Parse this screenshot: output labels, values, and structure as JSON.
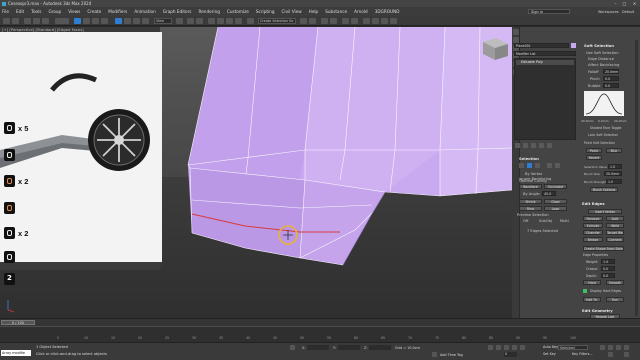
{
  "window": {
    "title": "Cesexopr3.max - Autodesk 3ds Max 2024",
    "sign_in": "Sign in",
    "workspaces_label": "Workspaces:",
    "workspace_value": "Default"
  },
  "menu": [
    "File",
    "Edit",
    "Tools",
    "Group",
    "Views",
    "Create",
    "Modifiers",
    "Animation",
    "Graph Editors",
    "Rendering",
    "Customize",
    "Scripting",
    "Civil View",
    "Help",
    "Substance",
    "Arnold",
    "3DGROUND"
  ],
  "toolbar": {
    "view_dropdown": "View",
    "selection_set": "Create Selection Se"
  },
  "viewport": {
    "label": "[+] [Perspective] [Standard] [Edged Faces]"
  },
  "reference": {
    "rows": [
      {
        "count": "x 5",
        "wheel_text": ""
      },
      {
        "count": "",
        "wheel_text": ""
      },
      {
        "count": "x 2",
        "wheel_text": ""
      },
      {
        "count": "",
        "wheel_text": ""
      },
      {
        "count": "x 2",
        "wheel_text": ""
      },
      {
        "count": "2",
        "wheel_text": ""
      }
    ]
  },
  "panel": {
    "object_name": "Plane001",
    "modifier_list": "Modifier List",
    "stack_item": "Editable Poly",
    "soft_selection": {
      "header": "Soft Selection",
      "use_soft": "Use Soft Selection",
      "edge_distance": "Edge Distance",
      "affect_backfacing": "Affect Backfacing",
      "falloff": "Falloff",
      "falloff_val": "20.0mm",
      "pinch": "Pinch",
      "pinch_val": "0.0",
      "bubble": "Bubble",
      "bubble_val": "0.0",
      "curve_ticks": [
        "20.0mm",
        "0.0mm",
        "20.0mm"
      ],
      "shaded_face": "Shaded Face Toggle",
      "lock_soft": "Lock Soft Selection",
      "paint_header": "Paint Soft Selection",
      "paint": "Paint",
      "blur": "Blur",
      "revert": "Revert",
      "selection_value": "Selection Value",
      "sel_val": "1.0",
      "brush_size": "Brush Size",
      "brush_size_val": "20.0mm",
      "brush_strength": "Brush Strength",
      "brush_strength_val": "1.0",
      "brush_options": "Brush Options"
    },
    "selection": {
      "header": "Selection",
      "by_vertex": "By Vertex",
      "ignore_backfacing": "Ignore Backfacing",
      "by_angle": "By Angle:",
      "angle_val": "45.0",
      "shrink": "Shrink",
      "grow": "Grow",
      "ring": "Ring",
      "loop": "Loop",
      "preview": "Preview Selection",
      "off": "Off",
      "subobj": "SubObj",
      "multi": "Multi",
      "status": "7 Edges Selected",
      "optimal_culling": "Optimal Culling",
      "backface": "Backface",
      "occluded": "Occluded"
    },
    "edit_edges": {
      "header": "Edit Edges",
      "insert_vertex": "Insert Vertex",
      "remove": "Remove",
      "split": "Split",
      "extrude": "Extrude",
      "weld": "Weld",
      "chamfer": "Chamfer",
      "target_weld": "Target Weld",
      "bridge": "Bridge",
      "connect": "Connect",
      "create_shape": "Create Shape From Selection",
      "edge_properties": "Edge Properties",
      "weight": "Weight:",
      "weight_val": "1.0",
      "crease": "Crease:",
      "crease_val": "0.0",
      "depth": "Depth:",
      "depth_val": "0.0",
      "hard": "Hard",
      "smooth": "Smooth",
      "display_hard": "Display Hard Edges",
      "edit_tri": "Edit Tri.",
      "turn": "Turn"
    },
    "edit_geometry": {
      "header": "Edit Geometry",
      "repeat_last": "Repeat Last"
    }
  },
  "timeline": {
    "frame": "0 / 100",
    "ticks": [
      "5",
      "10",
      "15",
      "20",
      "25",
      "30",
      "35",
      "40",
      "45",
      "50",
      "55",
      "60",
      "65",
      "70",
      "75",
      "80",
      "85",
      "90",
      "95",
      "100"
    ]
  },
  "status": {
    "script_box": "Array modifie",
    "objects_selected": "1 Object Selected",
    "hint": "Click or click-and-drag to select objects",
    "x_label": "X:",
    "y_label": "Y:",
    "z_label": "Z:",
    "grid_label": "Grid = 10.0cm",
    "add_time_tag": "Add Time Tag",
    "auto_key": "Auto Key",
    "selected": "Selected",
    "set_key": "Set Key",
    "key_filters": "Key Filters...",
    "frame_val": "0"
  },
  "colors": {
    "mesh": "#c8a8ee",
    "mesh_dark": "#b795e0",
    "accent_yellow": "#e8b23a",
    "selection_red": "#d63b3b"
  }
}
